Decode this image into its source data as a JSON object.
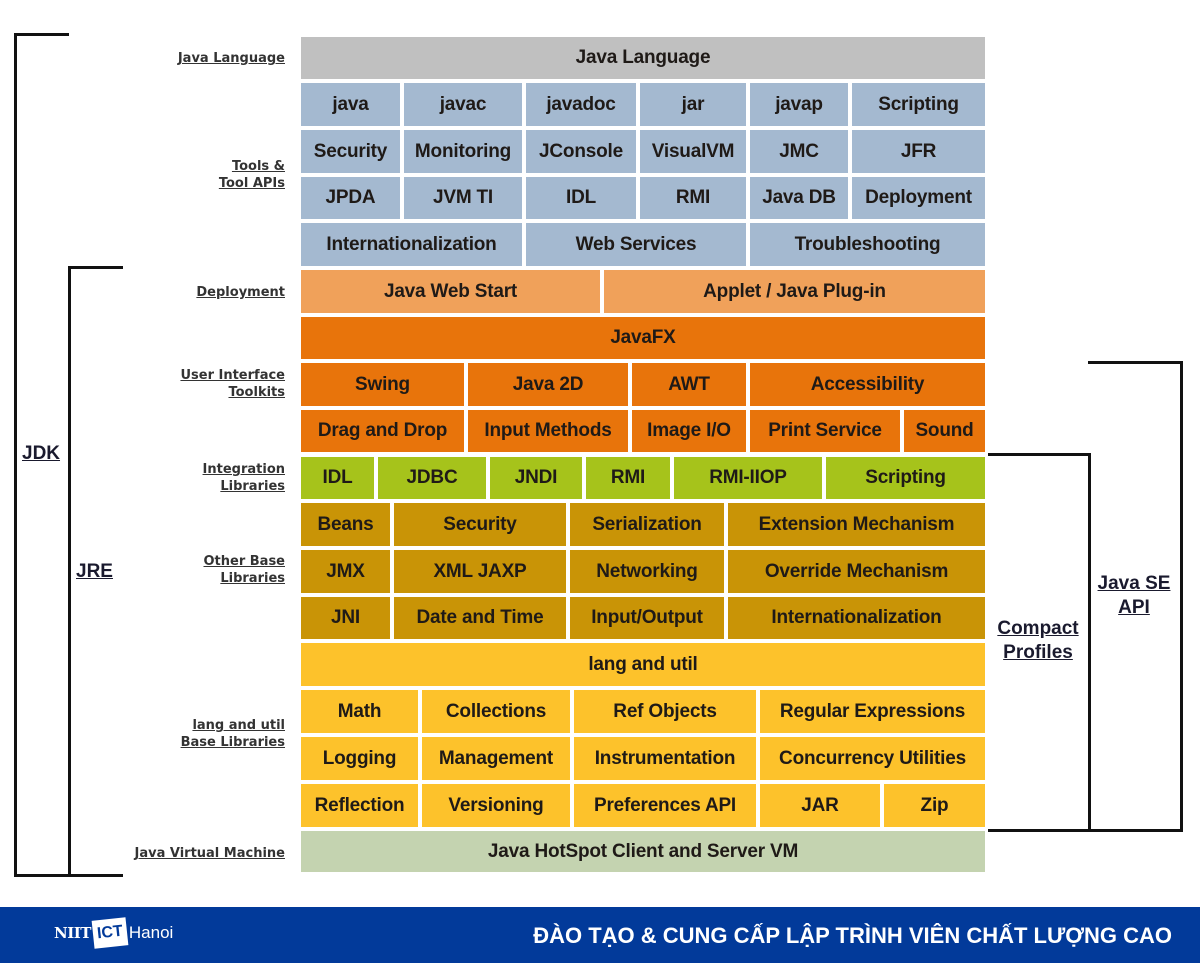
{
  "colors": {
    "language": "#c0c0c0",
    "tools": "#a4b9d0",
    "deployment": "#f0a15a",
    "ui": "#e8740b",
    "integration": "#a6c31b",
    "other_base": "#c99406",
    "lang_util": "#fdc22b",
    "jvm": "#c4d3b0",
    "footer": "#023a9a"
  },
  "left_labels": {
    "java_language": "Java Language",
    "tools_1": "Tools &",
    "tools_2": "Tool APIs",
    "deployment": "Deployment",
    "ui_1": "User Interface",
    "ui_2": "Toolkits",
    "integration_1": "Integration",
    "integration_2": "Libraries",
    "other_1": "Other Base",
    "other_2": "Libraries",
    "langutil_1": "lang and util",
    "langutil_2": "Base Libraries",
    "jvm": "Java Virtual Machine"
  },
  "brackets": {
    "jdk": "JDK",
    "jre": "JRE",
    "compact_1": "Compact",
    "compact_2": "Profiles",
    "javase_1": "Java SE",
    "javase_2": "API"
  },
  "rows": {
    "language": [
      "Java Language"
    ],
    "tools1": [
      "java",
      "javac",
      "javadoc",
      "jar",
      "javap",
      "Scripting"
    ],
    "tools2": [
      "Security",
      "Monitoring",
      "JConsole",
      "VisualVM",
      "JMC",
      "JFR"
    ],
    "tools3": [
      "JPDA",
      "JVM TI",
      "IDL",
      "RMI",
      "Java DB",
      "Deployment"
    ],
    "tools4": [
      "Internationalization",
      "Web Services",
      "Troubleshooting"
    ],
    "deploy": [
      "Java Web Start",
      "Applet / Java Plug-in"
    ],
    "javafx": [
      "JavaFX"
    ],
    "ui1": [
      "Swing",
      "Java 2D",
      "AWT",
      "Accessibility"
    ],
    "ui2": [
      "Drag and Drop",
      "Input Methods",
      "Image I/O",
      "Print Service",
      "Sound"
    ],
    "integ": [
      "IDL",
      "JDBC",
      "JNDI",
      "RMI",
      "RMI-IIOP",
      "Scripting"
    ],
    "other1": [
      "Beans",
      "Security",
      "Serialization",
      "Extension Mechanism"
    ],
    "other2": [
      "JMX",
      "XML JAXP",
      "Networking",
      "Override Mechanism"
    ],
    "other3": [
      "JNI",
      "Date and Time",
      "Input/Output",
      "Internationalization"
    ],
    "langutil": [
      "lang and util"
    ],
    "lu1": [
      "Math",
      "Collections",
      "Ref Objects",
      "Regular Expressions"
    ],
    "lu2": [
      "Logging",
      "Management",
      "Instrumentation",
      "Concurrency Utilities"
    ],
    "lu3": [
      "Reflection",
      "Versioning",
      "Preferences API",
      "JAR",
      "Zip"
    ],
    "jvm": [
      "Java HotSpot Client and Server VM"
    ]
  },
  "footer": {
    "logo_niit": "NIIT",
    "logo_ict": "ICT",
    "logo_hanoi": "Hanoi",
    "slogan": "ĐÀO TẠO & CUNG CẤP LẬP TRÌNH VIÊN CHẤT LƯỢNG CAO"
  }
}
